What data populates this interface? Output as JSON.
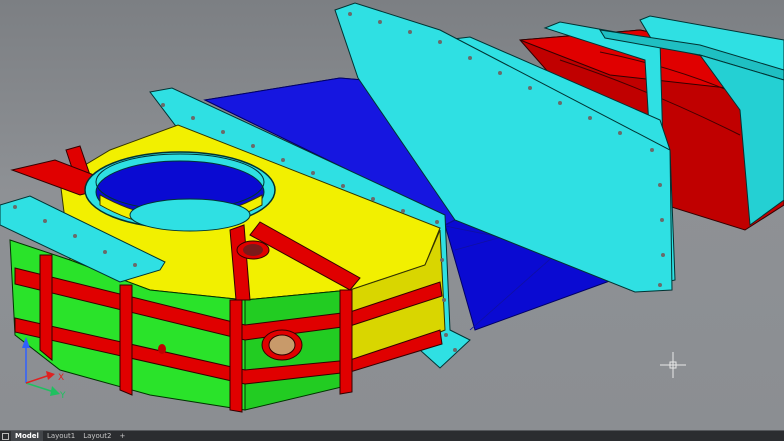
{
  "viewport": {
    "background": "#8a8d91",
    "ucs": {
      "x_label": "X",
      "y_label": "Y",
      "x_color": "#e02020",
      "y_color": "#20c060",
      "z_color": "#3060ff"
    },
    "model_colors": {
      "blue": "#0a0ad2",
      "cyan": "#2fe0e3",
      "red": "#d40000",
      "yellow": "#f2f000",
      "green": "#2ae32a"
    }
  },
  "layout_tabs": {
    "tabs": [
      "Model",
      "Layout1",
      "Layout2"
    ],
    "active": "Model",
    "add_label": "+"
  }
}
